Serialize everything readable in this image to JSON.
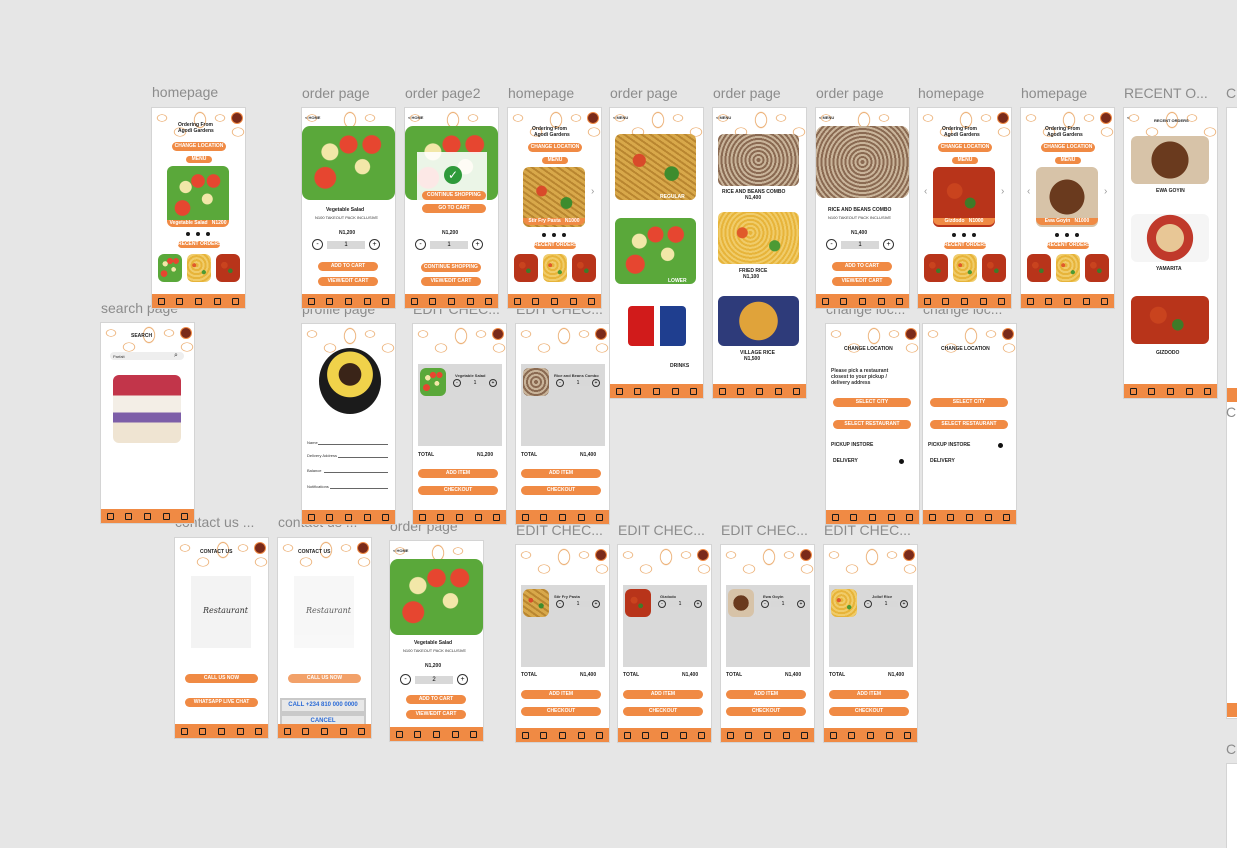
{
  "labels": {
    "f1": "homepage",
    "f2": "order page",
    "f3": "order page2",
    "f4": "homepage",
    "f5": "order page",
    "f6": "order page",
    "f7": "order page",
    "f8": "homepage",
    "f9": "homepage",
    "f10": "RECENT O...",
    "f11": "search page",
    "f12": "profile page",
    "f13": "EDIT CHEC...",
    "f14": "EDIT CHEC...",
    "f15": "change loc...",
    "f16": "change loc...",
    "f17": "contact us ...",
    "f18": "contact us ...",
    "f19": "order page",
    "f20": "EDIT CHEC...",
    "f21": "EDIT CHEC...",
    "f22": "EDIT CHEC...",
    "f23": "EDIT CHEC...",
    "edge": "C"
  },
  "common": {
    "ordering_from": "Ordering From",
    "agodi": "Agodi Gardens",
    "change_location": "CHANGE LOCATION",
    "menu": "MENU",
    "recent_orders": "RECENT ORDERS",
    "home": "HOME",
    "add_to_cart": "ADD TO CART",
    "view_edit_cart": "VIEW/EDIT CART",
    "continue_shopping": "CONTINUE SHOPPING",
    "go_to_cart": "GO TO CART",
    "add_item": "ADD ITEM",
    "checkout": "CHECKOUT",
    "total": "TOTAL",
    "search_title": "SEARCH",
    "search_value": "Parfait",
    "contact_us": "CONTACT US",
    "call_us_now": "CALL US NOW",
    "whatsapp": "WHATSAPP LIVE CHAT",
    "call_number": "CALL  +234 810 000 0000",
    "cancel": "CANCEL",
    "select_city": "SELECT CITY",
    "select_restaurant": "SELECT RESTAURANT",
    "pickup": "PICKUP INSTORE",
    "delivery": "DELIVERY",
    "pick_text": "Please pick a restaurant closest to your pickup / delivery address",
    "regular": "REGULAR",
    "lower": "LOWER",
    "drinks": "DRINKS",
    "recent_orders_title": "RECENT ORDERS",
    "restaurant_logo": "Restaurant",
    "tabs": [
      "HOME",
      "SEARCH",
      "ORDERS",
      "PROFILE",
      "CONTACT US"
    ]
  },
  "items": {
    "veg_salad": "Vegetable Salad",
    "veg_salad_desc": "N100 TAKEOUT PACK INCLUSIVE",
    "price_1200": "N1,200",
    "price_1400": "N1,400",
    "qty1": "1",
    "qty2": "2",
    "stir_fry": "Stir Fry Pasta",
    "stir_price": "N1000",
    "rice_beans": "RICE AND BEANS COMBO",
    "rice_beans_price": "N1,400",
    "fried_rice": "FRIED RICE",
    "fried_rice_price": "N1,100",
    "village_rice": "VILLAGE RICE",
    "village_price": "N1,500",
    "rice_beans_cart": "Rice and Beans Combo",
    "gizdodo": "Gizdodo",
    "ewa_goyin": "Ewa Goyin",
    "jollof": "Jollof Rice",
    "ewa_up": "EWA GOYIN",
    "yamarita": "YAMARITA",
    "gizdodo_up": "GIZDODO",
    "veg_small": "Vegetable Salad",
    "n1200": "N1200",
    "gizdodo_small": "Gizdodo",
    "ewa_small": "Ewa Goyin"
  },
  "profile": {
    "name": "Name",
    "address": "Delivery Address",
    "balance": "Balance",
    "notes": "Notifications"
  }
}
